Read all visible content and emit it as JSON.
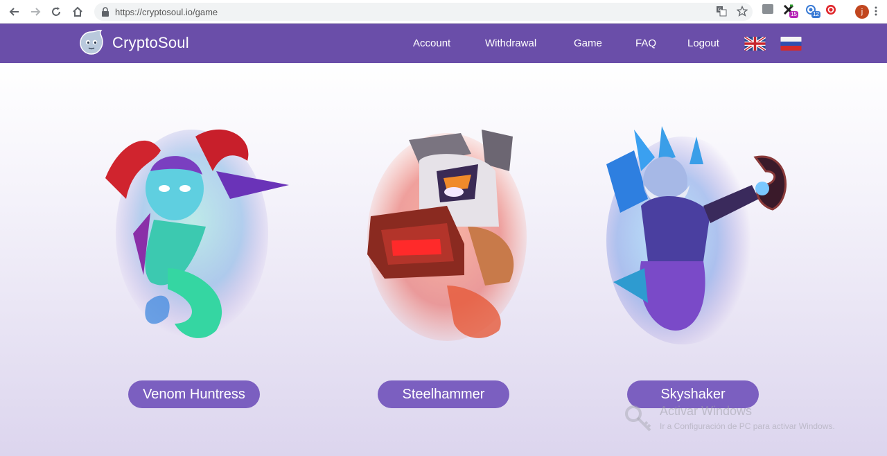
{
  "browser": {
    "url": "https://cryptosoul.io/game",
    "avatar_letter": "j",
    "badge_1": "15",
    "badge_2": "12"
  },
  "site": {
    "brand": "CryptoSoul",
    "nav": [
      "Account",
      "Withdrawal",
      "Game",
      "FAQ",
      "Logout"
    ]
  },
  "heroes": [
    {
      "name": "Venom Huntress"
    },
    {
      "name": "Steelhammer"
    },
    {
      "name": "Skyshaker"
    }
  ],
  "watermark": {
    "title": "Activar Windows",
    "subtitle": "Ir a Configuración de PC para activar Windows."
  },
  "colors": {
    "header": "#6a4ea9",
    "button": "#7b5fc0"
  }
}
